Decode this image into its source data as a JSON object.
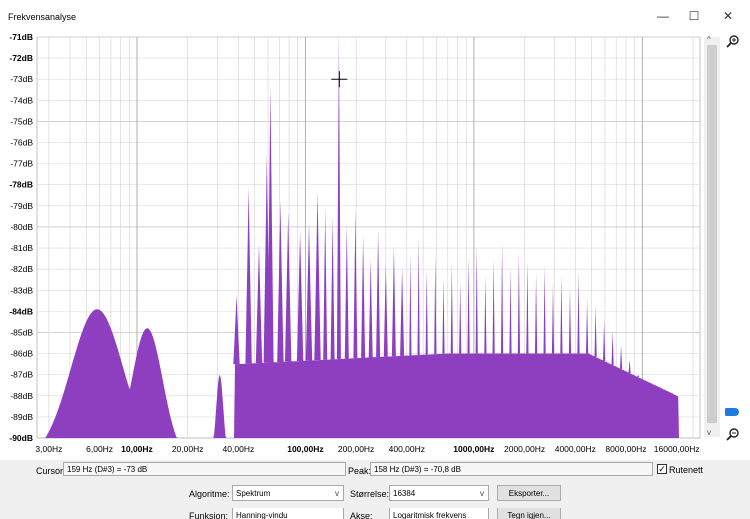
{
  "window": {
    "title": "Frekvensanalyse",
    "minimize": "—",
    "maximize": "☐",
    "close": "✕"
  },
  "chart_data": {
    "type": "area",
    "xscale": "log",
    "ylim": [
      -90,
      -71
    ],
    "y_ticks": [
      "-71dB",
      "-72dB",
      "-73dB",
      "-74dB",
      "-75dB",
      "-76dB",
      "-77dB",
      "-78dB",
      "-79dB",
      "-80dB",
      "-81dB",
      "-82dB",
      "-83dB",
      "-84dB",
      "-85dB",
      "-86dB",
      "-87dB",
      "-88dB",
      "-89dB",
      "-90dB"
    ],
    "x_ticks": [
      {
        "f": 3,
        "label": "3,00Hz"
      },
      {
        "f": 6,
        "label": "6,00Hz"
      },
      {
        "f": 10,
        "label": "10,00Hz",
        "bold": true
      },
      {
        "f": 20,
        "label": "20,00Hz"
      },
      {
        "f": 40,
        "label": "40,00Hz"
      },
      {
        "f": 100,
        "label": "100,00Hz",
        "bold": true
      },
      {
        "f": 200,
        "label": "200,00Hz"
      },
      {
        "f": 400,
        "label": "400,00Hz"
      },
      {
        "f": 1000,
        "label": "1000,00Hz",
        "bold": true
      },
      {
        "f": 2000,
        "label": "2000,00Hz"
      },
      {
        "f": 4000,
        "label": "4000,00Hz"
      },
      {
        "f": 8000,
        "label": "8000,00Hz"
      },
      {
        "f": 16000,
        "label": "16000,00Hz"
      }
    ],
    "peak": {
      "f": 158,
      "db": -70.8
    },
    "cursor": {
      "f": 159,
      "db": -73
    },
    "color": "#8e3fc0"
  },
  "controls": {
    "cursor_label": "Cursor:",
    "cursor_value": "159 Hz (D#3) = -73 dB",
    "peak_label": "Peak:",
    "peak_value": "158 Hz (D#3) = -70,8 dB",
    "grid_label": "Rutenett",
    "grid_checked": true,
    "algorithm_label": "Algoritme:",
    "algorithm_value": "Spektrum",
    "size_label": "Størrelse:",
    "size_value": "16384",
    "export_label": "Eksporter...",
    "function_label": "Funksjon:",
    "function_value": "Hanning-vindu",
    "axis_label": "Akse:",
    "axis_value": "Logaritmisk frekvens",
    "replot_label": "Tegn igjen..."
  }
}
